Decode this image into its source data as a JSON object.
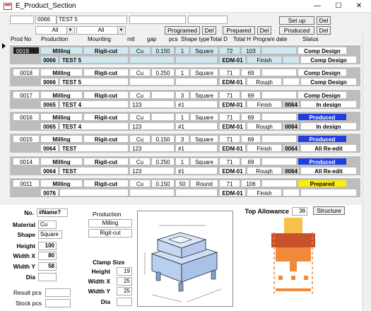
{
  "window": {
    "title": "E_Product_Section",
    "minimize": "—",
    "maximize": "☐",
    "close": "✕"
  },
  "filter": {
    "code": "0066",
    "name": "TEST 5",
    "production_value": "All",
    "mounting_value": "All"
  },
  "buttons": {
    "setup": "Set up",
    "del": "Del",
    "programed": "Programed",
    "prepared": "Prepared",
    "produced": "Produced"
  },
  "headers": [
    "Prod No",
    "Production",
    "Mounting",
    "mtl",
    "gap",
    "pcs",
    "Shape type",
    "Total D",
    "Total H",
    "Program date",
    "Status"
  ],
  "records": [
    {
      "prod_no": "0019",
      "production": "Milling",
      "mounting": "Rigit-cut",
      "mtl": "Cu",
      "gap": "0.150",
      "pcs": "1",
      "shape": "Square",
      "total_d": "72",
      "total_h": "103",
      "program_date": "",
      "status1": "Comp Design",
      "code": "0066",
      "name": "TEST 5",
      "r2c3": "",
      "r2c4": "",
      "machine": "EDM-01",
      "stage": "Finish",
      "prog_code": "",
      "status2": "Comp Design",
      "status2_color": "#ffffff",
      "status2_text": "#000000"
    },
    {
      "prod_no": "0018",
      "production": "Milling",
      "mounting": "Rigit-cut",
      "mtl": "Cu",
      "gap": "0.250",
      "pcs": "1",
      "shape": "Square",
      "total_d": "71",
      "total_h": "69",
      "program_date": "",
      "status1": "Comp Design",
      "code": "0066",
      "name": "TEST 5",
      "r2c3": "",
      "r2c4": "",
      "machine": "EDM-01",
      "stage": "Rough",
      "prog_code": "",
      "status2": "Comp Design",
      "status2_color": "#ffffff",
      "status2_text": "#000000"
    },
    {
      "prod_no": "0017",
      "production": "Milling",
      "mounting": "Rigit-cut",
      "mtl": "Cu",
      "gap": "",
      "pcs": "3",
      "shape": "Square",
      "total_d": "71",
      "total_h": "69",
      "program_date": "",
      "status1": "Comp Design",
      "code": "0065",
      "name": "TEST 4",
      "r2c3": "123",
      "r2c4": "#1",
      "machine": "EDM-01",
      "stage": "Finish",
      "prog_code": "0064",
      "status2": "In design",
      "status2_color": "#ffffff",
      "status2_text": "#000000"
    },
    {
      "prod_no": "0016",
      "production": "Milling",
      "mounting": "Rigit-cut",
      "mtl": "Cu",
      "gap": "",
      "pcs": "1",
      "shape": "Square",
      "total_d": "71",
      "total_h": "69",
      "program_date": "",
      "status1": "Produced",
      "code": "0065",
      "name": "TEST 4",
      "r2c3": "123",
      "r2c4": "#1",
      "machine": "EDM-01",
      "stage": "Rough",
      "prog_code": "0064",
      "status2": "In design",
      "status2_color": "#ffffff",
      "status2_text": "#000000"
    },
    {
      "prod_no": "0015",
      "production": "Milling",
      "mounting": "Rigit-cut",
      "mtl": "Cu",
      "gap": "0.150",
      "pcs": "3",
      "shape": "Square",
      "total_d": "71",
      "total_h": "69",
      "program_date": "",
      "status1": "Produced",
      "code": "0064",
      "name": "TEST",
      "r2c3": "123",
      "r2c4": "#1",
      "machine": "EDM-01",
      "stage": "Finish",
      "prog_code": "0064",
      "status2": "All Re-edit",
      "status2_color": "#ffffff",
      "status2_text": "#000000"
    },
    {
      "prod_no": "0014",
      "production": "Milling",
      "mounting": "Rigit-cut",
      "mtl": "Cu",
      "gap": "0.250",
      "pcs": "1",
      "shape": "Square",
      "total_d": "71",
      "total_h": "69",
      "program_date": "",
      "status1": "Produced",
      "code": "0064",
      "name": "TEST",
      "r2c3": "123",
      "r2c4": "#1",
      "machine": "EDM-01",
      "stage": "Rough",
      "prog_code": "0064",
      "status2": "All Re-edit",
      "status2_color": "#ffffff",
      "status2_text": "#000000"
    },
    {
      "prod_no": "0011",
      "production": "Milling",
      "mounting": "Rigit-cut",
      "mtl": "Cu",
      "gap": "0.150",
      "pcs": "50",
      "shape": "Round",
      "total_d": "71",
      "total_h": "106",
      "program_date": "",
      "status1": "Prepared",
      "code": "0076",
      "name": "",
      "r2c3": "",
      "r2c4": "",
      "machine": "EDM-01",
      "stage": "Finish",
      "prog_code": "",
      "status2": "",
      "status2_color": "#ffffff",
      "status2_text": "#000000"
    }
  ],
  "status_colors": {
    "Comp Design": "#ffffff",
    "Produced": "#1f3fe0",
    "Prepared": "#ffee00"
  },
  "detail": {
    "no_label": "No.",
    "no_value": "#Name?",
    "material_label": "Material",
    "material_value": "Cu",
    "shape_label": "Shape",
    "shape_value": "Square",
    "height_label": "Height",
    "height_value": "100",
    "width_x_label": "Width X",
    "width_x_value": "80",
    "width_y_label": "Width Y",
    "width_y_value": "58",
    "dia_label": "Dia",
    "dia_value": "",
    "result_label": "Result pcs",
    "stock_label": "Stock pcs",
    "production_title": "Production",
    "production_values": [
      "Milling",
      "Rigit-cut"
    ],
    "clamp_title": "Clamp Size",
    "clamp_height_label": "Height",
    "clamp_height": "19",
    "clamp_width_x_label": "Width X",
    "clamp_width_x": "25",
    "clamp_width_y_label": "Width Y",
    "clamp_width_y": "25",
    "clamp_dia_label": "Dia",
    "clamp_dia": "",
    "top_allowance_label": "Top Allowance",
    "top_allowance": "38",
    "structure_button": "Structure"
  }
}
